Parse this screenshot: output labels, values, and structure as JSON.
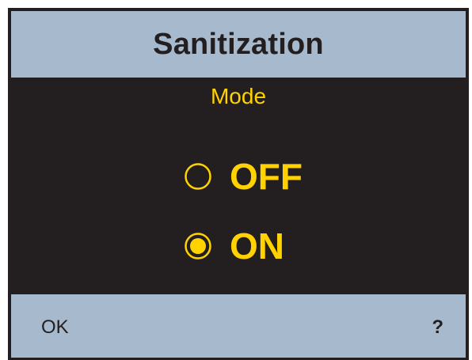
{
  "colors": {
    "background": "#231f20",
    "panel": "#a7b9cc",
    "accent": "#ffd200",
    "text_dark": "#231f20"
  },
  "header": {
    "title": "Sanitization"
  },
  "main": {
    "label": "Mode",
    "options": [
      {
        "label": "OFF",
        "selected": false,
        "icon": "radio-unselected-icon"
      },
      {
        "label": "ON",
        "selected": true,
        "icon": "radio-selected-icon"
      }
    ]
  },
  "footer": {
    "ok_label": "OK",
    "help_label": "?"
  }
}
